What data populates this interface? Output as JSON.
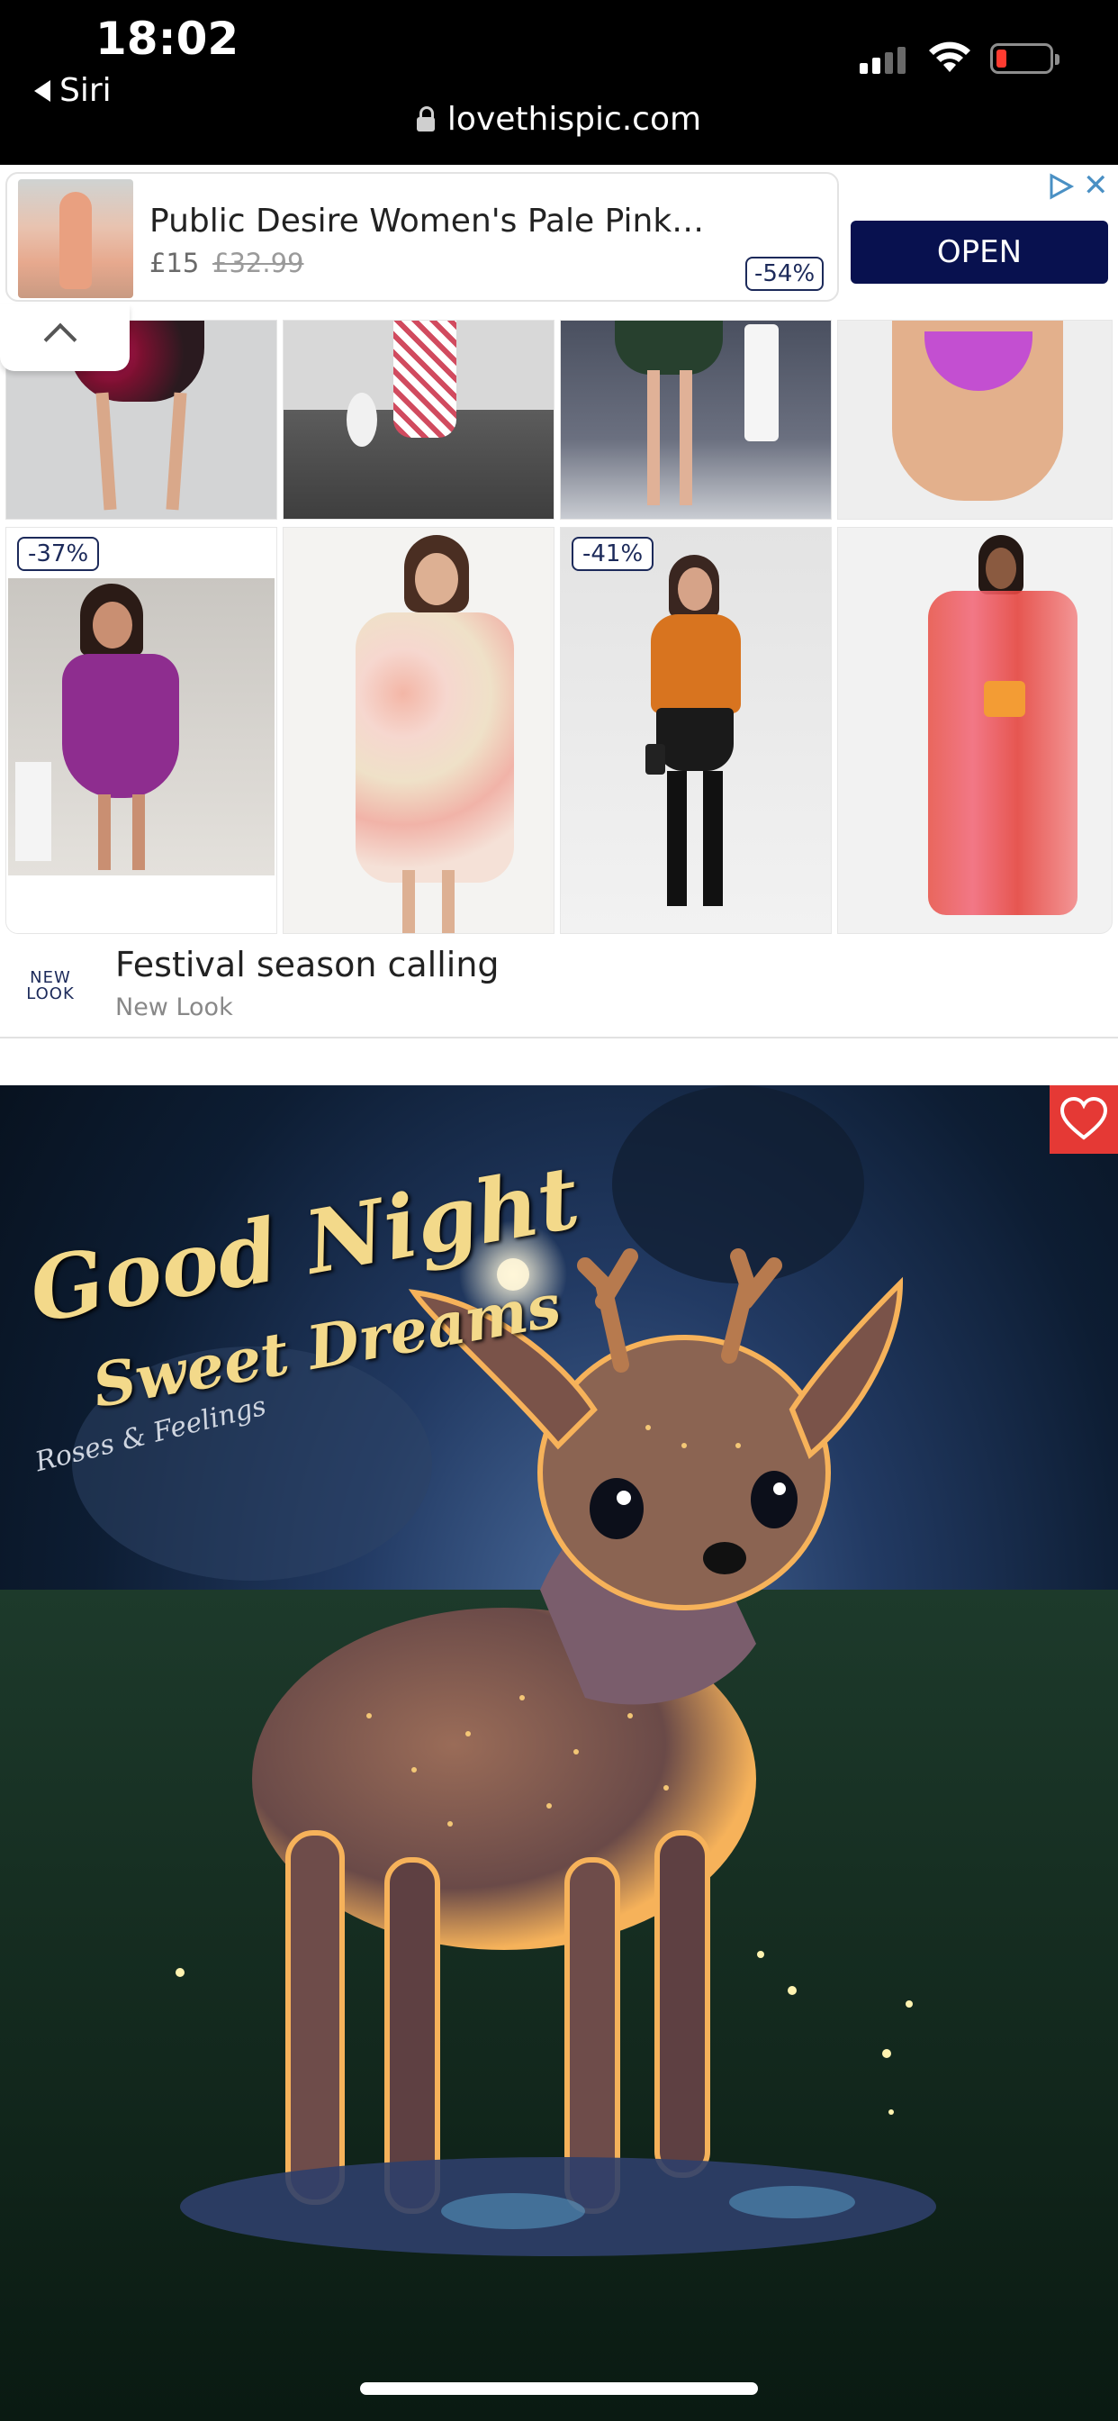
{
  "status_bar": {
    "time": "18:02",
    "back_app": "Siri",
    "url": "lovethispic.com",
    "battery_color": "#ff3b30"
  },
  "ad_banner": {
    "title": "Public Desire Women's Pale Pink…",
    "price": "£15",
    "old_price": "£32.99",
    "discount": "-54%",
    "cta": "OPEN",
    "close_glyph": "✕",
    "adchoices_icon": "adchoices-icon"
  },
  "product_grid": {
    "row2_badges": [
      "-37%",
      "-41%"
    ]
  },
  "ad_source": {
    "logo_line1": "NEW",
    "logo_line2": "LOOK",
    "title": "Festival season calling",
    "subtitle": "New Look"
  },
  "picture": {
    "title": "Good Night",
    "subtitle": "Sweet Dreams",
    "signature": "Roses & Feelings",
    "favorite_icon": "heart-icon",
    "accent": "#e53935"
  }
}
